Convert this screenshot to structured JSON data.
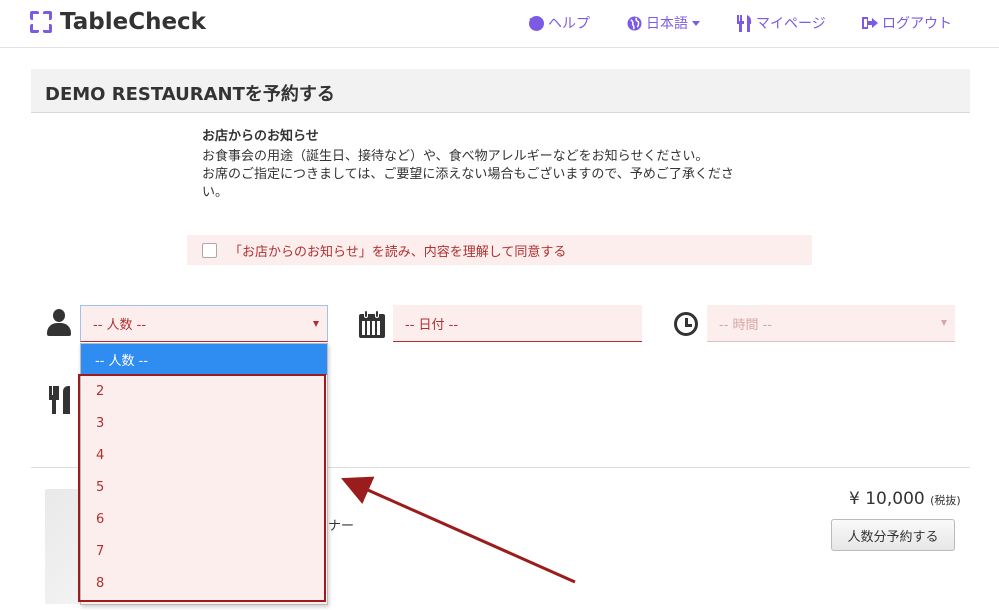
{
  "header": {
    "logo_text": "TableCheck",
    "nav": {
      "help": "ヘルプ",
      "language": "日本語",
      "mypage": "マイページ",
      "logout": "ログアウト"
    }
  },
  "page": {
    "title": "DEMO RESTAURANTを予約する"
  },
  "notice": {
    "title": "お店からのお知らせ",
    "body": "お食事会の用途（誕生日、接待など）や、食べ物アレルギーなどをお知らせください。\nお席のご指定につきましては、ご要望に添えない場合もございますので、予めご了承くださ\nい。",
    "agree_label": "「お店からのお知らせ」を読み、内容を理解して同意する"
  },
  "form": {
    "party_placeholder": "-- 人数 --",
    "date_placeholder": "-- 日付 --",
    "time_placeholder": "-- 時間 --"
  },
  "dropdown": {
    "selected": "-- 人数 --",
    "options": [
      "2",
      "3",
      "4",
      "5",
      "6",
      "7",
      "8"
    ]
  },
  "course": {
    "name_fragment": "ナー",
    "price": "¥ 10,000",
    "tax_note": "(税抜)",
    "book_button": "人数分予約する"
  },
  "colors": {
    "brand": "#7b5be6",
    "error_text": "#b03030",
    "error_bg": "#fdeeee",
    "selected_option": "#2f8cf0",
    "annotation": "#9b1c1c"
  }
}
